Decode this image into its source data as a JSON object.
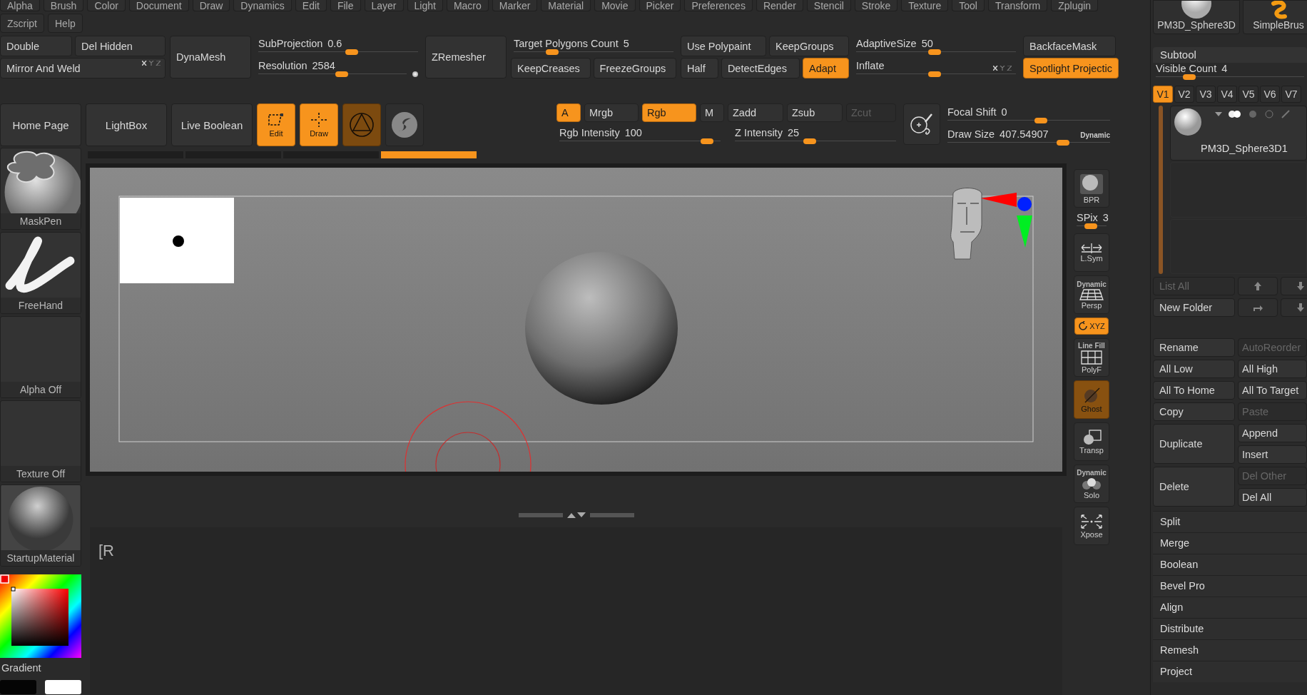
{
  "menu": {
    "rows": [
      [
        "Alpha",
        "Brush",
        "Color",
        "Document",
        "Draw",
        "Dynamics",
        "Edit",
        "File",
        "Layer",
        "Light",
        "Macro",
        "Marker",
        "Material",
        "Movie",
        "Picker",
        "Preferences",
        "Render",
        "Stencil",
        "Stroke",
        "Texture",
        "Tool",
        "Transform",
        "Zplugin"
      ],
      [
        "Zscript",
        "Help"
      ]
    ]
  },
  "palette": [
    {
      "rows": [
        [
          {
            "kind": "button",
            "label": "Double",
            "on": false
          },
          {
            "kind": "button",
            "label": "Del Hidden",
            "on": false
          }
        ],
        [
          {
            "kind": "button",
            "label": "Mirror And Weld",
            "on": false,
            "axes": true
          }
        ]
      ]
    },
    {
      "rows": [
        [
          {
            "kind": "tall",
            "label": "DynaMesh",
            "on": false
          }
        ]
      ]
    },
    {
      "rows": [
        [
          {
            "kind": "slider",
            "label": "SubProjection",
            "value": "0.6",
            "level": 0.59
          }
        ],
        [
          {
            "kind": "slider",
            "label": "Resolution",
            "value": "2584",
            "level": 0.57,
            "marker": true
          }
        ]
      ]
    },
    {
      "rows": [
        [
          {
            "kind": "tall",
            "label": "ZRemesher",
            "on": false
          }
        ]
      ]
    },
    {
      "rows": [
        [
          {
            "kind": "slider",
            "label": "Target Polygons Count",
            "value": "5",
            "level": 0.22
          }
        ],
        [
          {
            "kind": "button",
            "label": "KeepCreases",
            "on": false
          },
          {
            "kind": "button",
            "label": "FreezeGroups",
            "on": false
          }
        ]
      ]
    },
    {
      "rows": [
        [
          {
            "kind": "button",
            "label": "Use Polypaint",
            "on": false
          },
          {
            "kind": "button",
            "label": "KeepGroups",
            "on": false
          }
        ],
        [
          {
            "kind": "button",
            "label": "Half",
            "on": false
          },
          {
            "kind": "button",
            "label": "DetectEdges",
            "on": false
          },
          {
            "kind": "button",
            "label": "Adapt",
            "on": true
          }
        ]
      ]
    },
    {
      "rows": [
        [
          {
            "kind": "slider",
            "label": "AdaptiveSize",
            "value": "50",
            "level": 0.49
          }
        ],
        [
          {
            "kind": "slider",
            "label": "Inflate",
            "level": 0.49,
            "axes": true
          }
        ]
      ]
    },
    {
      "rows": [
        [
          {
            "kind": "button",
            "label": "BackfaceMask",
            "on": false
          }
        ],
        [
          {
            "kind": "button",
            "label": "Spotlight Projectic",
            "on": true
          }
        ]
      ]
    }
  ],
  "toolbar": {
    "buttons": [
      "Home Page",
      "LightBox",
      "Live Boolean"
    ],
    "modes": [
      {
        "kind": "edit",
        "label": "Edit",
        "on": true,
        "dim": false
      },
      {
        "kind": "draw",
        "label": "Draw",
        "on": true,
        "dim": false
      },
      {
        "kind": "material",
        "on": true,
        "dim": true
      },
      {
        "kind": "sphere",
        "on": false,
        "dim": false
      }
    ],
    "color_buttons": [
      {
        "label": "A",
        "on": true,
        "disabled": false
      },
      {
        "label": "Mrgb",
        "on": false,
        "disabled": false
      },
      {
        "label": "Rgb",
        "on": true,
        "disabled": false
      },
      {
        "label": "M",
        "on": false,
        "disabled": false
      },
      {
        "label": "Zadd",
        "on": false,
        "disabled": false
      },
      {
        "label": "Zsub",
        "on": false,
        "disabled": false
      },
      {
        "label": "Zcut",
        "on": false,
        "disabled": true
      }
    ],
    "intensity_sliders": [
      {
        "label": "Rgb Intensity",
        "value": "100",
        "level": 0.95
      },
      {
        "label": "Z Intensity",
        "value": "25",
        "level": 0.46
      }
    ],
    "stroke_sliders": [
      {
        "label": "Focal Shift",
        "value": "0",
        "level": 0.58
      },
      {
        "label": "Draw Size",
        "value": "407.54907",
        "level": 0.73,
        "tag": "Dynamic"
      }
    ]
  },
  "progress": [
    {
      "selected": false
    },
    {
      "selected": false
    },
    {
      "selected": false
    },
    {
      "selected": true
    }
  ],
  "left_panel": {
    "thumbnails": [
      {
        "kind": "maskpen",
        "label": "MaskPen"
      },
      {
        "kind": "freehand",
        "label": "FreeHand"
      },
      {
        "kind": "blank",
        "label": "Alpha Off"
      },
      {
        "kind": "blank",
        "label": "Texture Off"
      },
      {
        "kind": "material",
        "label": "StartupMaterial"
      }
    ],
    "gradient": "Gradient"
  },
  "console": {
    "text": "[R"
  },
  "shelf": [
    {
      "kind": "bpr",
      "label": "BPR",
      "on": false,
      "dim": false
    },
    {
      "kind": "slider",
      "label": "SPix",
      "value": "3",
      "level": 0.45
    },
    {
      "kind": "lsym",
      "label": "L.Sym",
      "on": false,
      "dim": false
    },
    {
      "kind": "persp",
      "label": "Persp",
      "tag": "Dynamic",
      "on": false,
      "dim": false
    },
    {
      "kind": "xyz",
      "label": "XYZ",
      "on": true,
      "dim": false
    },
    {
      "kind": "polyf",
      "label": "PolyF",
      "tag": "Line Fill",
      "on": false,
      "dim": false
    },
    {
      "kind": "ghost",
      "label": "Ghost",
      "on": true,
      "dim": true
    },
    {
      "kind": "transp",
      "label": "Transp",
      "on": false,
      "dim": false
    },
    {
      "kind": "solo",
      "label": "Solo",
      "tag": "Dynamic",
      "on": false,
      "dim": false
    },
    {
      "kind": "xpose",
      "label": "Xpose",
      "on": false,
      "dim": false
    }
  ],
  "right_panel": {
    "thumbs": [
      {
        "kind": "sphere",
        "label": "PM3D_Sphere3D"
      },
      {
        "kind": "brush",
        "label": "SimpleBrus"
      }
    ],
    "subtool": {
      "title": "Subtool",
      "visible_count": {
        "label": "Visible Count",
        "value": "4",
        "level": 0.2
      },
      "versions": [
        {
          "label": "V1",
          "selected": true
        },
        {
          "label": "V2",
          "selected": false
        },
        {
          "label": "V3",
          "selected": false
        },
        {
          "label": "V4",
          "selected": false
        },
        {
          "label": "V5",
          "selected": false
        },
        {
          "label": "V6",
          "selected": false
        },
        {
          "label": "V7",
          "selected": false
        }
      ],
      "items": [
        {
          "name": "PM3D_Sphere3D1"
        }
      ],
      "list_buttons": [
        {
          "label": "List All",
          "disabled": true
        },
        {
          "label": "New Folder",
          "disabled": false
        }
      ],
      "button_rows": [
        {
          "left": {
            "label": "Rename",
            "disabled": false
          },
          "right": [
            {
              "label": "AutoReorder",
              "disabled": true
            }
          ]
        },
        {
          "left": {
            "label": "All Low",
            "disabled": false
          },
          "right": [
            {
              "label": "All High",
              "disabled": false
            }
          ]
        },
        {
          "left": {
            "label": "All To Home",
            "disabled": false
          },
          "right": [
            {
              "label": "All To Target",
              "disabled": false
            }
          ]
        },
        {
          "left": {
            "label": "Copy",
            "disabled": false
          },
          "right": [
            {
              "label": "Paste",
              "disabled": true
            }
          ]
        },
        {
          "left": {
            "label": "Duplicate",
            "disabled": false
          },
          "right": [
            {
              "label": "Append",
              "disabled": false
            },
            {
              "label": "Insert",
              "disabled": false
            }
          ]
        },
        {
          "left": {
            "label": "Delete",
            "disabled": false
          },
          "right": [
            {
              "label": "Del Other",
              "disabled": true
            },
            {
              "label": "Del All",
              "disabled": false
            }
          ]
        }
      ],
      "sections": [
        "Split",
        "Merge",
        "Boolean",
        "Bevel Pro",
        "Align",
        "Distribute",
        "Remesh",
        "Project"
      ]
    }
  }
}
